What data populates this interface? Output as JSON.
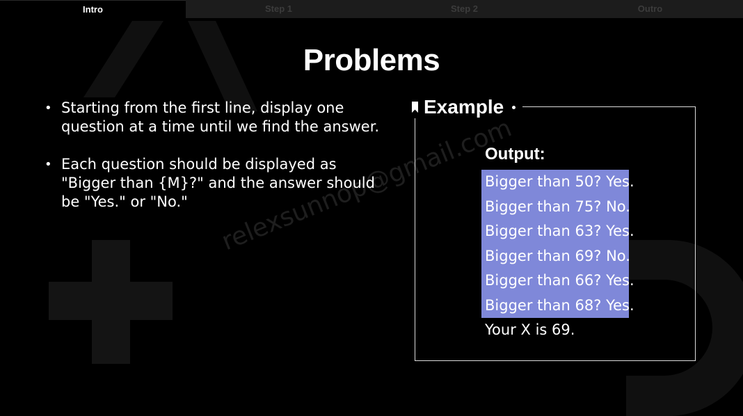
{
  "tabs": [
    {
      "label": "Intro",
      "active": true
    },
    {
      "label": "Step 1",
      "active": false
    },
    {
      "label": "Step 2",
      "active": false
    },
    {
      "label": "Outro",
      "active": false
    }
  ],
  "title": "Problems",
  "bullets": [
    "Starting from the first line, display one question at a time until we find the answer.",
    "Each question should be displayed as \"Bigger than {M}?\" and the answer should be \"Yes.\" or \"No.\""
  ],
  "example": {
    "heading": "Example",
    "output_label": "Output:",
    "highlighted_lines": [
      "Bigger than 50? Yes.",
      "Bigger than 75? No.",
      "Bigger than 63? Yes.",
      "Bigger than 69? No.",
      "Bigger than 66? Yes.",
      "Bigger than 68? Yes."
    ],
    "final_line": "Your X is 69."
  },
  "watermark": "relexsunnop@gmail.com",
  "colors": {
    "background": "#000000",
    "highlight": "#7f88d9",
    "inactive_tab": "#1c1c1c",
    "inactive_tab_text": "#3c3c3c"
  }
}
